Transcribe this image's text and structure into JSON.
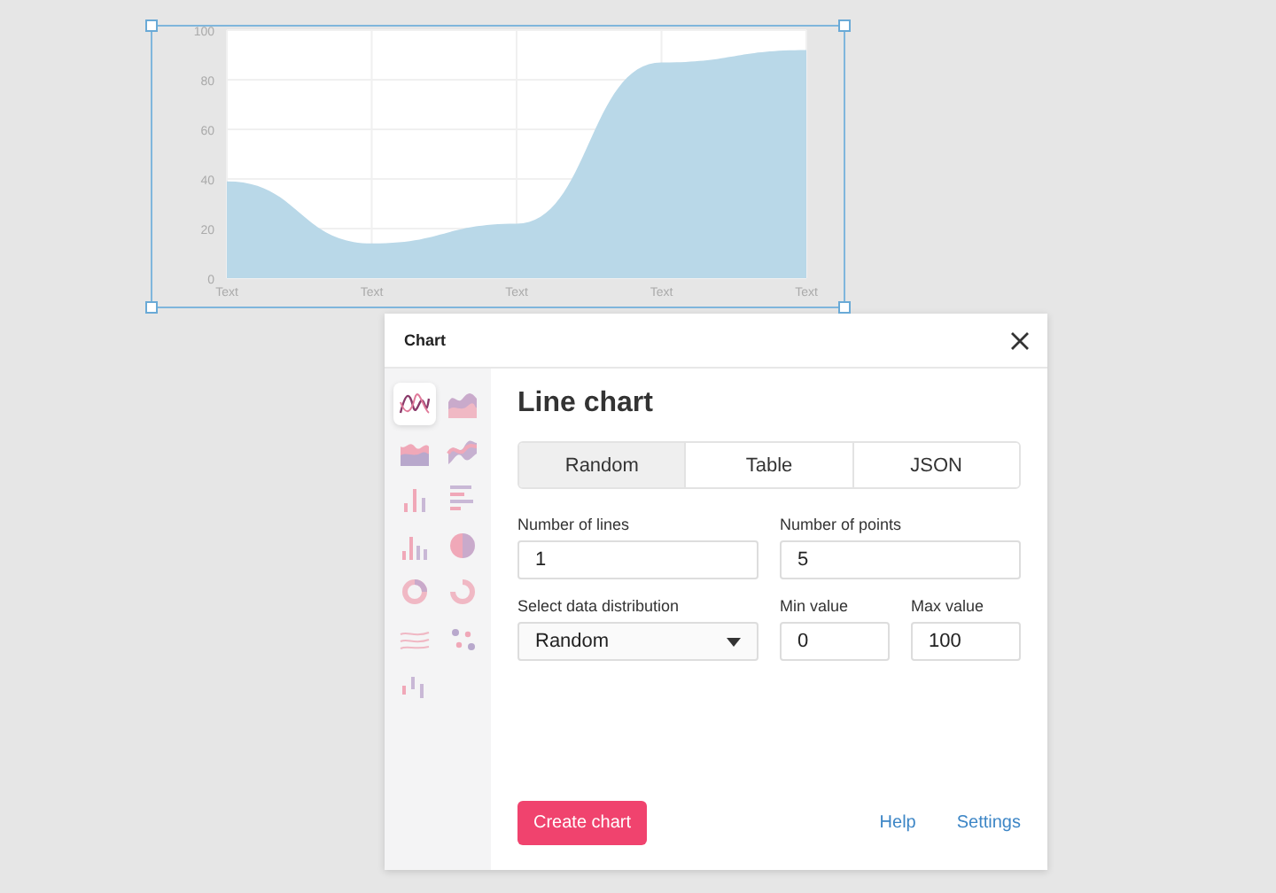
{
  "chart": {
    "chart_data": {
      "type": "area",
      "categories": [
        "Text",
        "Text",
        "Text",
        "Text",
        "Text"
      ],
      "series": [
        {
          "color": "#b9d8e8",
          "values": [
            39,
            14,
            22,
            87,
            92
          ]
        }
      ],
      "grid": true,
      "ylim": [
        0,
        100
      ],
      "yticks": [
        0,
        20,
        40,
        60,
        80,
        100
      ]
    }
  },
  "dialog": {
    "title": "Chart",
    "chart_types": [
      {
        "kind": "line",
        "selected": true
      },
      {
        "kind": "area",
        "selected": false
      },
      {
        "kind": "stacked-area",
        "selected": false
      },
      {
        "kind": "stream",
        "selected": false
      },
      {
        "kind": "bar",
        "selected": false
      },
      {
        "kind": "hbar",
        "selected": false
      },
      {
        "kind": "grouped-bar",
        "selected": false
      },
      {
        "kind": "pie",
        "selected": false
      },
      {
        "kind": "donut",
        "selected": false
      },
      {
        "kind": "half-donut",
        "selected": false
      },
      {
        "kind": "lines",
        "selected": false
      },
      {
        "kind": "scatter",
        "selected": false
      },
      {
        "kind": "candle",
        "selected": false
      }
    ],
    "heading": "Line chart",
    "tabs": [
      {
        "label": "Random",
        "selected": true
      },
      {
        "label": "Table",
        "selected": false
      },
      {
        "label": "JSON",
        "selected": false
      }
    ],
    "fields": {
      "lines": {
        "label": "Number of lines",
        "value": "1"
      },
      "points": {
        "label": "Number of points",
        "value": "5"
      },
      "distribution": {
        "label": "Select data distribution",
        "value": "Random"
      },
      "min": {
        "label": "Min value",
        "value": "0"
      },
      "max": {
        "label": "Max value",
        "value": "100"
      }
    },
    "create_button": "Create chart",
    "links": [
      "Help",
      "Settings"
    ]
  }
}
